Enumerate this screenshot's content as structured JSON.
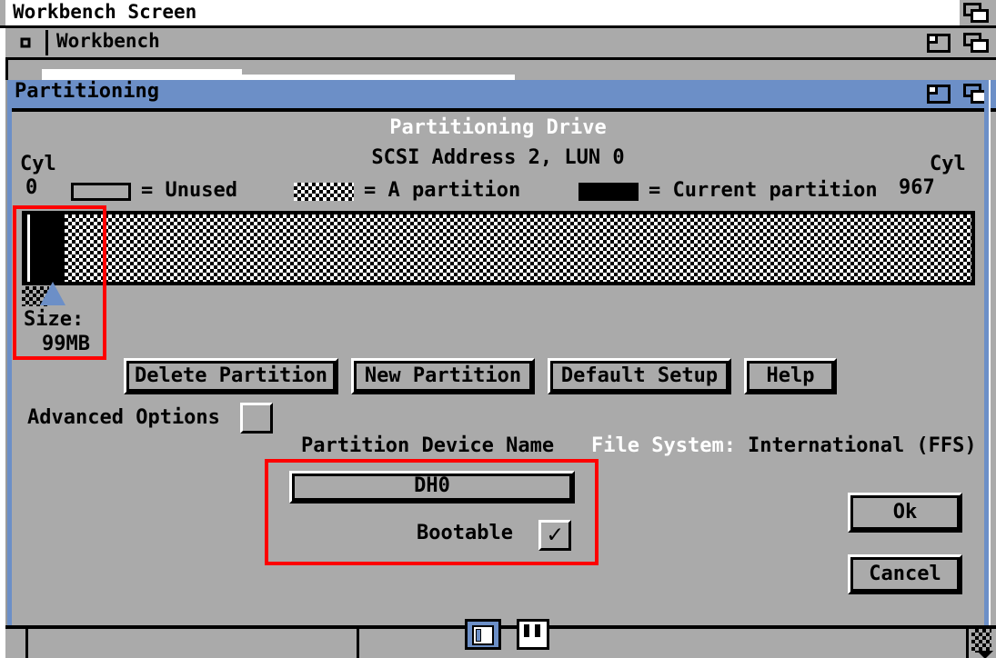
{
  "screen": {
    "title": "Workbench Screen",
    "depth_gadget_icon": "depth-arrange-icon"
  },
  "workbench_window": {
    "title": "Workbench",
    "close_gadget_icon": "close-icon",
    "zoom_gadget_icon": "zoom-icon",
    "depth_gadget_icon": "depth-arrange-icon"
  },
  "partitioning_window": {
    "title": "Partitioning",
    "zoom_gadget_icon": "zoom-icon",
    "depth_gadget_icon": "depth-arrange-icon",
    "heading_line1": "Partitioning Drive",
    "heading_line2": "SCSI Address 2, LUN 0",
    "cyl_left_label": "Cyl",
    "cyl_left_value": "0",
    "cyl_right_label": "Cyl",
    "cyl_right_value": "967",
    "legend": [
      {
        "swatch": "unused",
        "text": "= Unused"
      },
      {
        "swatch": "a-partition",
        "text": "= A partition"
      },
      {
        "swatch": "current-partition",
        "text": "= Current partition"
      }
    ],
    "size_label": "Size:",
    "size_value": "99MB",
    "buttons": [
      {
        "name": "delete-partition",
        "label": "Delete Partition"
      },
      {
        "name": "new-partition",
        "label": "New Partition"
      },
      {
        "name": "default-setup",
        "label": "Default Setup"
      },
      {
        "name": "help",
        "label": "Help"
      }
    ],
    "advanced_options_label": "Advanced Options",
    "advanced_options_checked": false,
    "device_name_label": "Partition Device Name",
    "device_name_value": "DH0",
    "bootable_label": "Bootable",
    "bootable_checked": true,
    "bootable_tick": "✓",
    "file_system_label": "File System:",
    "file_system_value": "International (FFS)",
    "ok_label": "Ok",
    "cancel_label": "Cancel"
  },
  "bottom_bar": {
    "icons": [
      {
        "name": "floppy-disk-icon"
      },
      {
        "name": "hard-drive-icon"
      }
    ],
    "scroll_down_icon": "scroll-down-arrow-icon"
  },
  "annotations": {
    "highlight_color": "#ff0000",
    "boxes": [
      {
        "name": "size-region-highlight"
      },
      {
        "name": "device-name-region-highlight"
      }
    ]
  },
  "colors": {
    "window_gray": "#aaaaaa",
    "title_blue": "#6c8fc7",
    "black": "#000000",
    "white": "#ffffff",
    "highlight_red": "#ff0000"
  }
}
